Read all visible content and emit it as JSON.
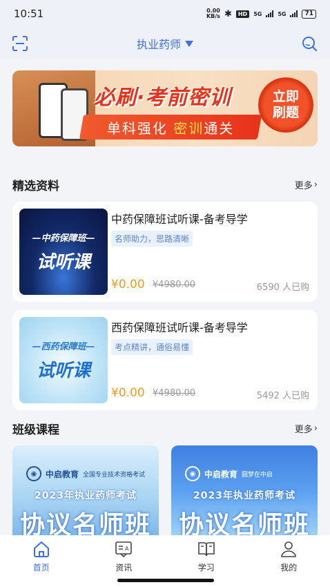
{
  "status_bar": {
    "time": "10:51",
    "net_speed_top": "0.00",
    "net_speed_bottom": "KB/s",
    "hd": "HD",
    "sig1": "5G",
    "sig2": "5G",
    "battery": "71"
  },
  "header": {
    "title": "执业药师"
  },
  "banner": {
    "headline": "必刷·考前密训",
    "ribbon_plain": "单科强化 ",
    "ribbon_highlight": "密训",
    "ribbon_end": "通关",
    "cta_line1": "立即",
    "cta_line2": "刷题"
  },
  "featured": {
    "title": "精选资料",
    "more": "更多",
    "items": [
      {
        "thumb_sub": "—中药保障班—",
        "thumb_big": "试听课",
        "title": "中药保障班试听课-备考导学",
        "tag": "名师助力，思路清晰",
        "price": "¥0.00",
        "original_price": "¥4980.00",
        "sold": "6590 人已购"
      },
      {
        "thumb_sub": "—西药保障班—",
        "thumb_big": "试听课",
        "title": "西药保障班试听课-备考导学",
        "tag": "考点精讲，通俗易懂",
        "price": "¥0.00",
        "original_price": "¥4980.00",
        "sold": "5492 人已购"
      }
    ]
  },
  "classes": {
    "title": "班级课程",
    "more": "更多",
    "items": [
      {
        "brand": "中启教育",
        "slogan": "全国专业技术资格考试",
        "year": "2023年执业药师考试",
        "name": "协议名师班"
      },
      {
        "brand": "中启教育",
        "slogan": "圆梦在中启",
        "year": "2023年执业药师考试",
        "name": "协议名师班"
      }
    ]
  },
  "tabbar": [
    {
      "label": "首页",
      "icon": "home-icon",
      "active": true
    },
    {
      "label": "资讯",
      "icon": "news-icon",
      "active": false
    },
    {
      "label": "学习",
      "icon": "book-icon",
      "active": false
    },
    {
      "label": "我的",
      "icon": "profile-icon",
      "active": false
    }
  ],
  "colors": {
    "accent": "#3d6fe6",
    "price": "#f29b1d",
    "banner_red": "#e8331b"
  }
}
